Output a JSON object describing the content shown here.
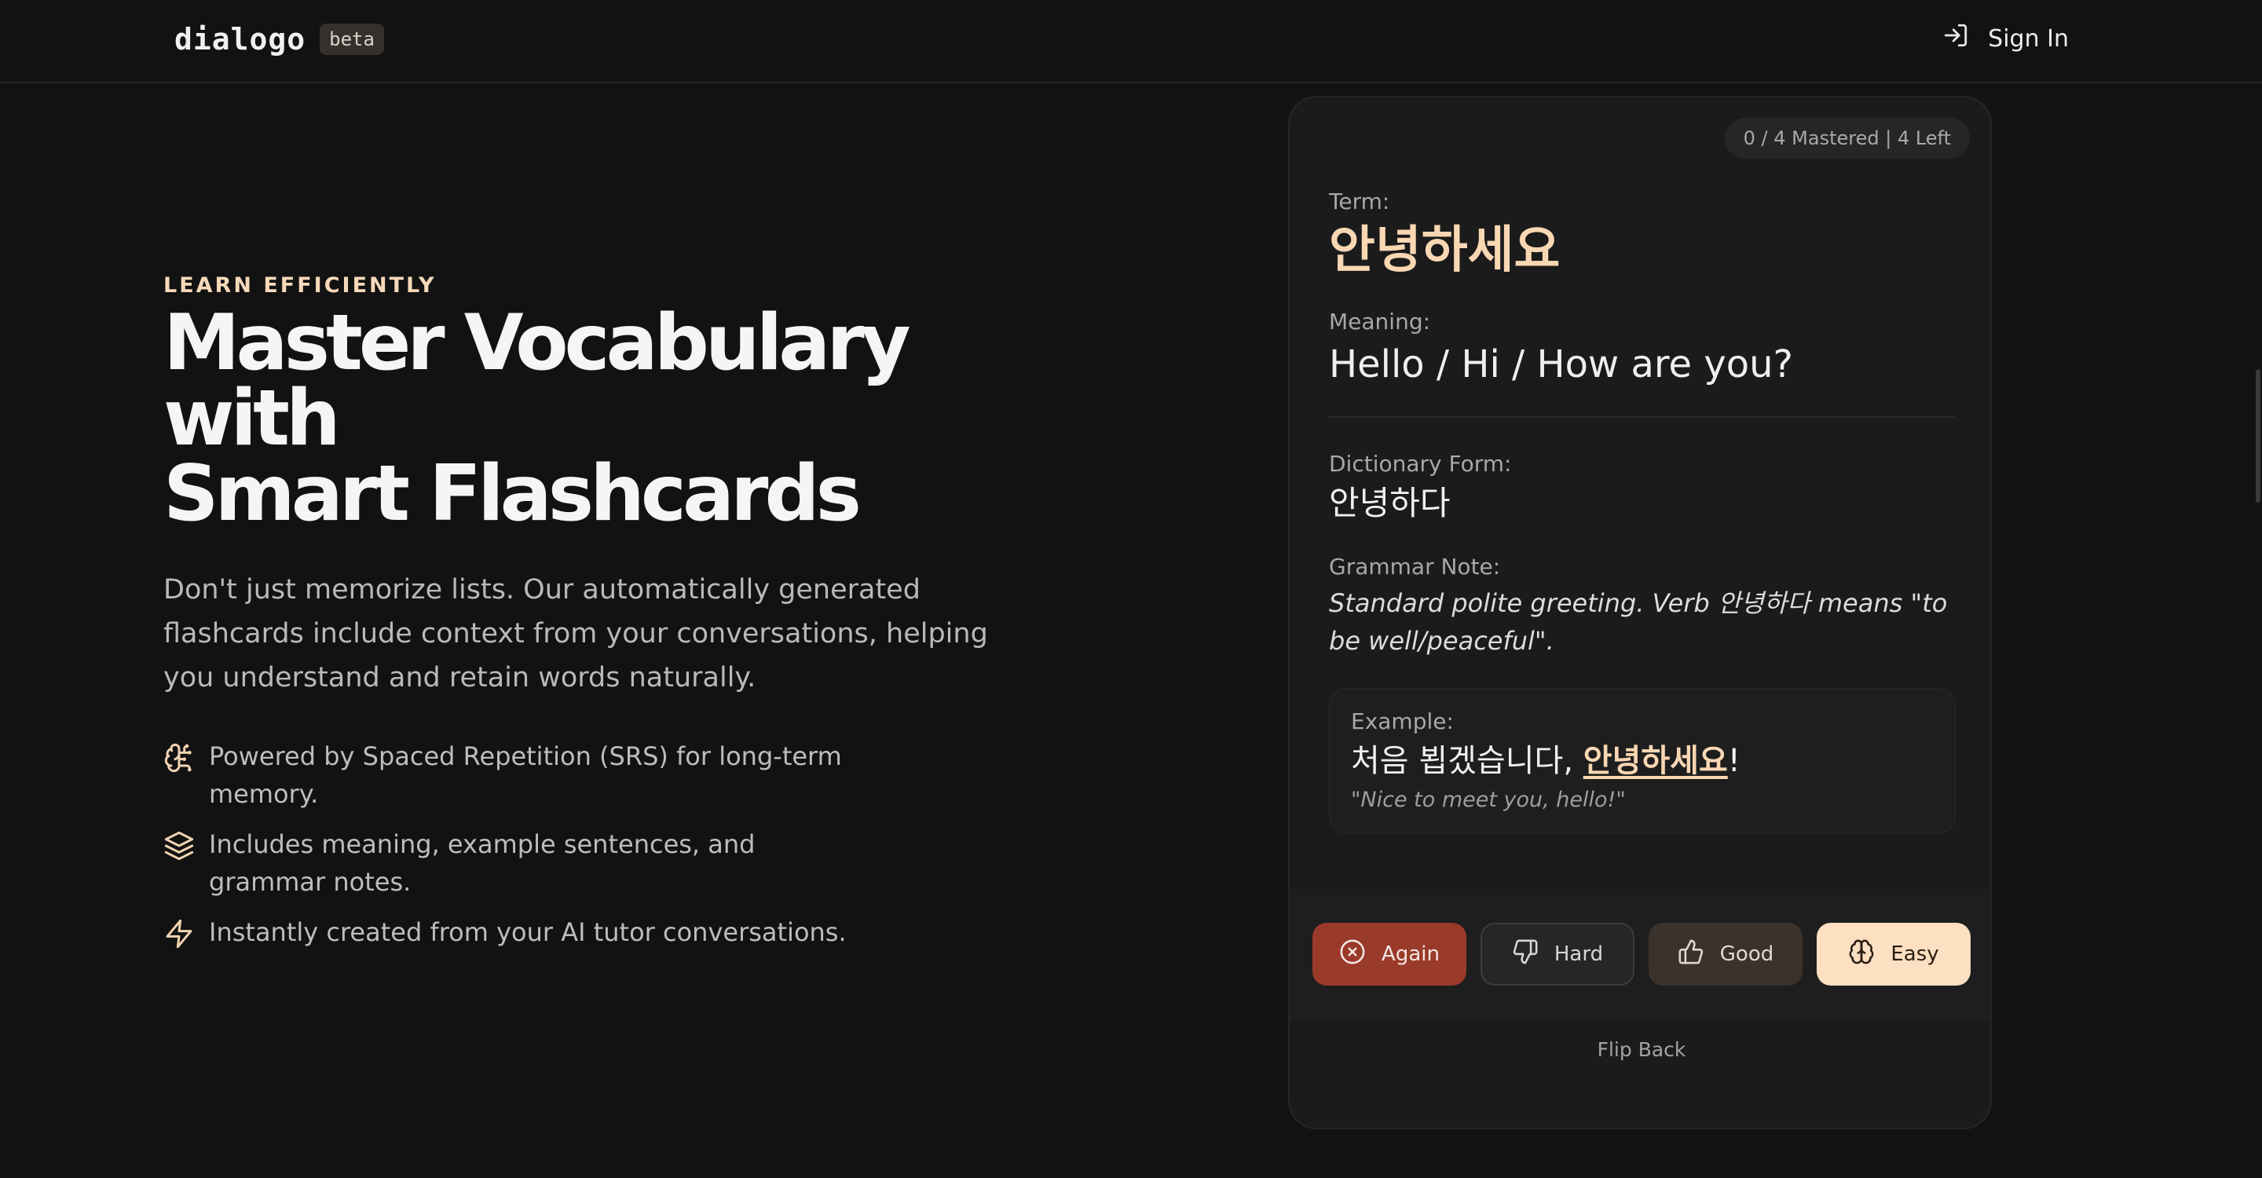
{
  "header": {
    "brand": "dialogo",
    "badge": "beta",
    "signin_label": "Sign In",
    "signin_icon": "log-in-icon"
  },
  "hero": {
    "eyebrow": "LEARN EFFICIENTLY",
    "headline_line1": "Master Vocabulary with",
    "headline_line2": "Smart Flashcards",
    "subcopy": "Don't just memorize lists. Our automatically generated flashcards include context from your conversations, helping you understand and retain words naturally.",
    "features": [
      {
        "icon": "brain-icon",
        "text": "Powered by Spaced Repetition (SRS) for long-term memory."
      },
      {
        "icon": "layers-icon",
        "text": "Includes meaning, example sentences, and grammar notes."
      },
      {
        "icon": "zap-icon",
        "text": "Instantly created from your AI tutor conversations."
      }
    ]
  },
  "card": {
    "progress": "0 / 4 Mastered | 4 Left",
    "term_label": "Term:",
    "term": "안녕하세요",
    "meaning_label": "Meaning:",
    "meaning": "Hello / Hi / How are you?",
    "dict_label": "Dictionary Form:",
    "dict_form": "안녕하다",
    "grammar_label": "Grammar Note:",
    "grammar_note": "Standard polite greeting. Verb 안녕하다 means \"to be well/peaceful\".",
    "example_label": "Example:",
    "example_prefix": "처음 뵙겠습니다, ",
    "example_highlight": "안녕하세요",
    "example_suffix": "!",
    "example_translation": "\"Nice to meet you, hello!\"",
    "buttons": {
      "again": "Again",
      "hard": "Hard",
      "good": "Good",
      "easy": "Easy"
    },
    "flip_back": "Flip Back"
  },
  "colors": {
    "accent": "#f9d7b3",
    "again": "#9a3a2a",
    "easy": "#fddfc1",
    "background": "#121212"
  }
}
